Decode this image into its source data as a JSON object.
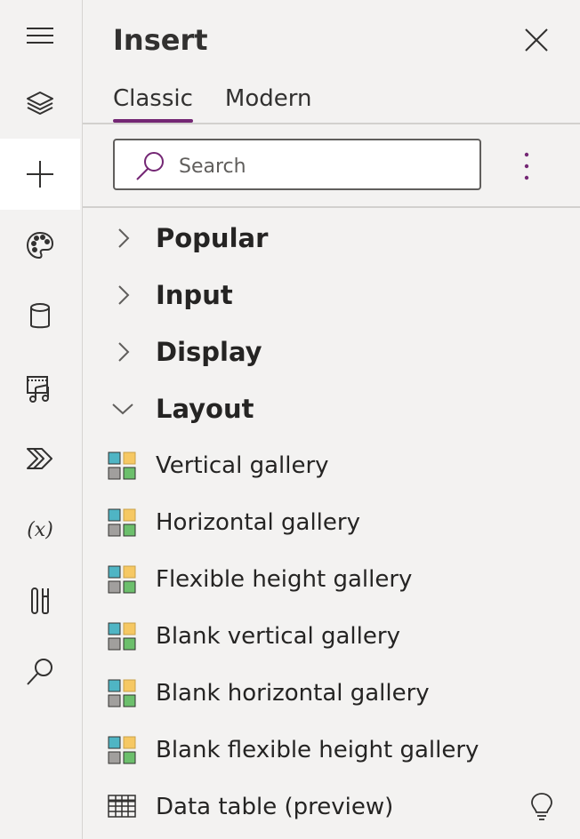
{
  "rail": {
    "items": [
      {
        "name": "hamburger-menu-icon"
      },
      {
        "name": "layers-icon"
      },
      {
        "name": "plus-icon",
        "active": true
      },
      {
        "name": "palette-icon"
      },
      {
        "name": "database-icon"
      },
      {
        "name": "media-icon"
      },
      {
        "name": "power-automate-icon"
      },
      {
        "name": "variables-icon"
      },
      {
        "name": "tools-icon"
      },
      {
        "name": "search-icon"
      }
    ]
  },
  "panel": {
    "title": "Insert",
    "tabs": [
      {
        "label": "Classic",
        "active": true
      },
      {
        "label": "Modern",
        "active": false
      }
    ],
    "search": {
      "placeholder": "Search",
      "value": ""
    },
    "categories": [
      {
        "label": "Popular",
        "expanded": false
      },
      {
        "label": "Input",
        "expanded": false
      },
      {
        "label": "Display",
        "expanded": false
      },
      {
        "label": "Layout",
        "expanded": true
      }
    ],
    "layout_items": [
      {
        "label": "Vertical gallery",
        "icon": "gallery-icon"
      },
      {
        "label": "Horizontal gallery",
        "icon": "gallery-icon"
      },
      {
        "label": "Flexible height gallery",
        "icon": "gallery-icon"
      },
      {
        "label": "Blank vertical gallery",
        "icon": "gallery-icon"
      },
      {
        "label": "Blank horizontal gallery",
        "icon": "gallery-icon"
      },
      {
        "label": "Blank flexible height gallery",
        "icon": "gallery-icon"
      },
      {
        "label": "Data table (preview)",
        "icon": "table-icon",
        "extra_icon": "lightbulb-icon"
      }
    ]
  },
  "colors": {
    "accent": "#742774",
    "gallery_teal": "#4fb5c4",
    "gallery_yellow": "#f6c863",
    "gallery_gray": "#a19f9d",
    "gallery_green": "#6cbf6c"
  }
}
